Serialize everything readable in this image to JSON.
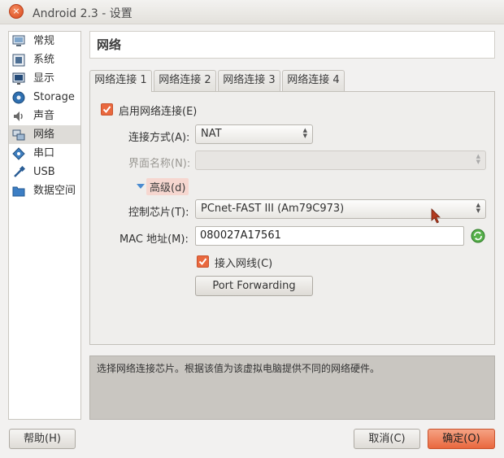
{
  "window": {
    "title": "Android 2.3 - 设置",
    "close_glyph": "×"
  },
  "sidebar": {
    "items": [
      {
        "label": "常规",
        "icon": "monitor-icon"
      },
      {
        "label": "系统",
        "icon": "chip-icon"
      },
      {
        "label": "显示",
        "icon": "display-icon"
      },
      {
        "label": "Storage",
        "icon": "disk-icon"
      },
      {
        "label": "声音",
        "icon": "speaker-icon"
      },
      {
        "label": "网络",
        "icon": "network-icon"
      },
      {
        "label": "串口",
        "icon": "serial-icon"
      },
      {
        "label": "USB",
        "icon": "usb-icon"
      },
      {
        "label": "数据空间",
        "icon": "folder-icon"
      }
    ],
    "active_index": 5
  },
  "section": {
    "title": "网络"
  },
  "tabs": [
    {
      "label": "网络连接 1",
      "active": true
    },
    {
      "label": "网络连接 2",
      "active": false
    },
    {
      "label": "网络连接 3",
      "active": false
    },
    {
      "label": "网络连接 4",
      "active": false
    }
  ],
  "adapter": {
    "enable_label": "启用网络连接(E)",
    "enable_checked": true,
    "attach_label": "连接方式(A):",
    "attach_value": "NAT",
    "name_label": "界面名称(N):",
    "name_value": "",
    "advanced_label": "高级(d)",
    "chip_label": "控制芯片(T):",
    "chip_value": "PCnet-FAST III (Am79C973)",
    "mac_label": "MAC 地址(M):",
    "mac_value": "080027A17561",
    "cable_label": "接入网线(C)",
    "cable_checked": true,
    "port_forwarding_label": "Port Forwarding"
  },
  "description": "选择网络连接芯片。根据该值为该虚拟电脑提供不同的网络硬件。",
  "footer": {
    "help_label": "帮助(H)",
    "cancel_label": "取消(C)",
    "ok_label": "确定(O)"
  },
  "colors": {
    "accent": "#e9683e",
    "expander": "#4a8bd0",
    "description_bg": "#c9c6c1"
  }
}
